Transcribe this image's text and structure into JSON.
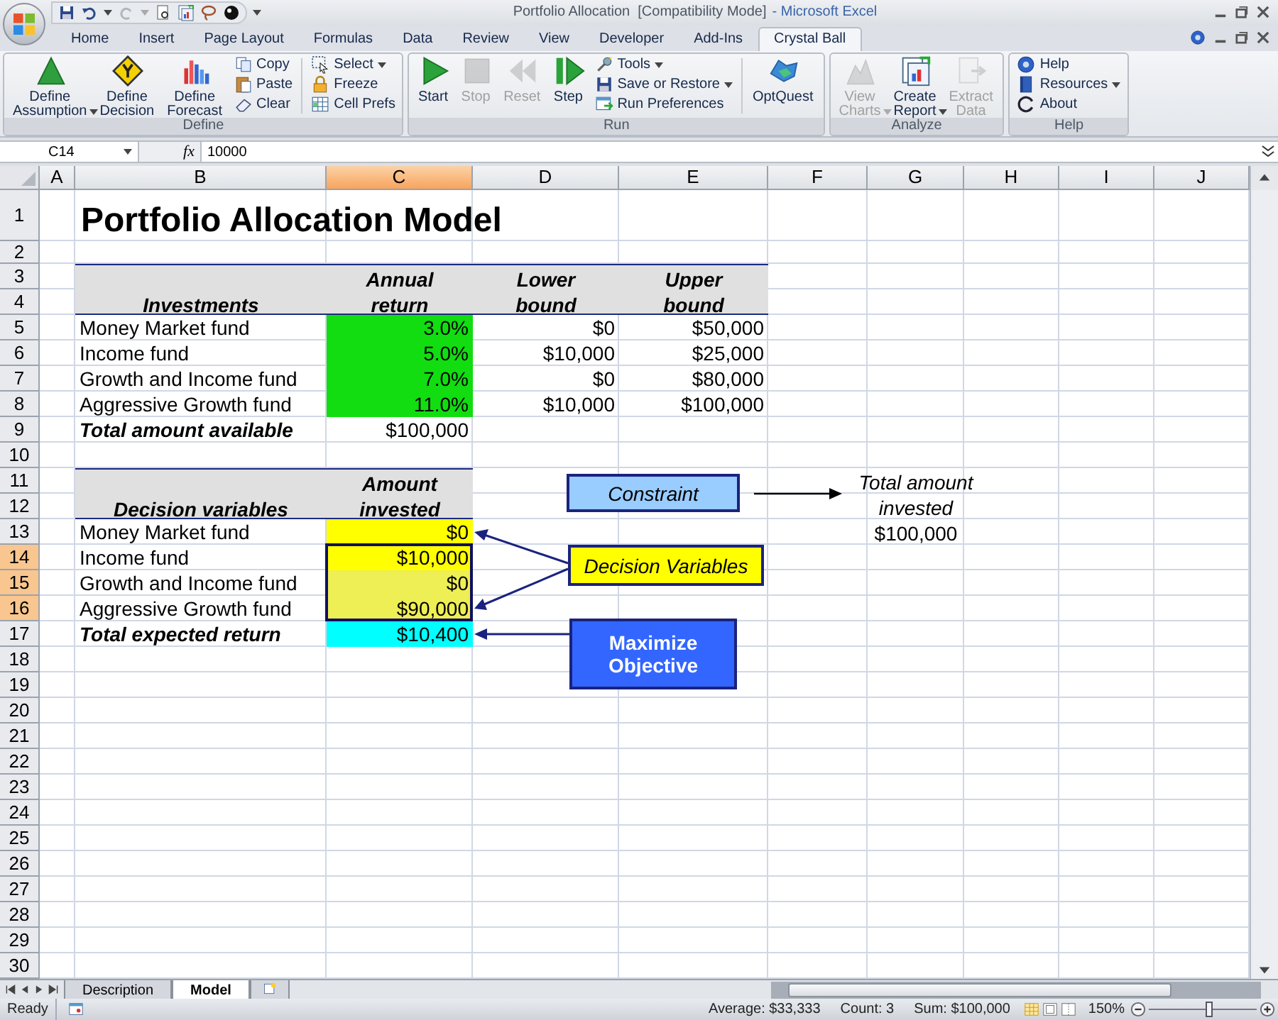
{
  "window": {
    "document": "Portfolio Allocation  [Compatibility Mode]",
    "app": "- Microsoft Excel"
  },
  "ribbon_tabs": [
    {
      "label": "Home",
      "selected": false
    },
    {
      "label": "Insert",
      "selected": false
    },
    {
      "label": "Page Layout",
      "selected": false
    },
    {
      "label": "Formulas",
      "selected": false
    },
    {
      "label": "Data",
      "selected": false
    },
    {
      "label": "Review",
      "selected": false
    },
    {
      "label": "View",
      "selected": false
    },
    {
      "label": "Developer",
      "selected": false
    },
    {
      "label": "Add-Ins",
      "selected": false
    },
    {
      "label": "Crystal Ball",
      "selected": true
    }
  ],
  "ribbon_groups": [
    {
      "label": "Define",
      "items": [
        {
          "label": "Define Assumption",
          "kind": "large",
          "dropdown": true,
          "disabled": false
        },
        {
          "label": "Define Decision",
          "kind": "large",
          "dropdown": false,
          "disabled": false
        },
        {
          "label": "Define Forecast",
          "kind": "large",
          "dropdown": false,
          "disabled": false
        },
        {
          "label": "Copy",
          "kind": "small",
          "dropdown": false,
          "disabled": false
        },
        {
          "label": "Paste",
          "kind": "small",
          "dropdown": false,
          "disabled": false
        },
        {
          "label": "Clear",
          "kind": "small",
          "dropdown": false,
          "disabled": false
        },
        {
          "label": "Select",
          "kind": "small",
          "dropdown": true,
          "disabled": false
        },
        {
          "label": "Freeze",
          "kind": "small",
          "dropdown": false,
          "disabled": false
        },
        {
          "label": "Cell Prefs",
          "kind": "small",
          "dropdown": false,
          "disabled": false
        }
      ]
    },
    {
      "label": "Run",
      "items": [
        {
          "label": "Start",
          "kind": "large",
          "dropdown": false,
          "disabled": false
        },
        {
          "label": "Stop",
          "kind": "large",
          "dropdown": false,
          "disabled": true
        },
        {
          "label": "Reset",
          "kind": "large",
          "dropdown": false,
          "disabled": true
        },
        {
          "label": "Step",
          "kind": "large",
          "dropdown": false,
          "disabled": false
        },
        {
          "label": "Tools",
          "kind": "small",
          "dropdown": true,
          "disabled": false
        },
        {
          "label": "Save or Restore",
          "kind": "small",
          "dropdown": true,
          "disabled": false
        },
        {
          "label": "Run Preferences",
          "kind": "small",
          "dropdown": false,
          "disabled": false
        },
        {
          "label": "OptQuest",
          "kind": "large",
          "dropdown": false,
          "disabled": false
        }
      ]
    },
    {
      "label": "Analyze",
      "items": [
        {
          "label": "View Charts",
          "kind": "large",
          "dropdown": true,
          "disabled": true
        },
        {
          "label": "Create Report",
          "kind": "large",
          "dropdown": true,
          "disabled": false
        },
        {
          "label": "Extract Data",
          "kind": "large",
          "dropdown": false,
          "disabled": true
        }
      ]
    },
    {
      "label": "Help",
      "items": [
        {
          "label": "Help",
          "kind": "small",
          "dropdown": false,
          "disabled": false
        },
        {
          "label": "Resources",
          "kind": "small",
          "dropdown": true,
          "disabled": false
        },
        {
          "label": "About",
          "kind": "small",
          "dropdown": false,
          "disabled": false
        }
      ]
    }
  ],
  "formula_bar": {
    "name_box": "C14",
    "function_label": "fx",
    "formula": "10000"
  },
  "columns": [
    {
      "label": "A",
      "selected": false
    },
    {
      "label": "B",
      "selected": false
    },
    {
      "label": "C",
      "selected": true
    },
    {
      "label": "D",
      "selected": false
    },
    {
      "label": "E",
      "selected": false
    },
    {
      "label": "F",
      "selected": false
    },
    {
      "label": "G",
      "selected": false
    },
    {
      "label": "H",
      "selected": false
    },
    {
      "label": "I",
      "selected": false
    },
    {
      "label": "J",
      "selected": false
    }
  ],
  "rows": [
    {
      "label": "1",
      "selected": false,
      "cells": [
        {
          "kind": "title",
          "text": "Portfolio Allocation Model"
        }
      ]
    },
    {
      "label": "2",
      "selected": false
    },
    {
      "label": "3",
      "selected": false,
      "cells": [
        {
          "kind": "header_top",
          "color": "#e0e0e0"
        },
        {
          "kind": "header_top",
          "text": "Annual",
          "color": "#e0e0e0"
        },
        {
          "kind": "header_top",
          "text": "Lower",
          "color": "#e0e0e0"
        },
        {
          "kind": "header_top",
          "text": "Upper",
          "color": "#e0e0e0"
        }
      ]
    },
    {
      "label": "4",
      "selected": false,
      "cells": [
        {
          "kind": "header_bottom",
          "text": "Investments",
          "color": "#e0e0e0"
        },
        {
          "kind": "header_bottom",
          "text": "return",
          "color": "#e0e0e0"
        },
        {
          "kind": "header_bottom",
          "text": "bound",
          "color": "#e0e0e0"
        },
        {
          "kind": "header_bottom",
          "text": "bound",
          "color": "#e0e0e0"
        }
      ]
    },
    {
      "label": "5",
      "selected": false,
      "cells": [
        {
          "kind": "label",
          "text": "Money Market fund"
        },
        {
          "kind": "value",
          "text": "3.0%",
          "color": "#11dd11"
        },
        {
          "kind": "value",
          "text": "$0"
        },
        {
          "kind": "value",
          "text": "$50,000"
        }
      ]
    },
    {
      "label": "6",
      "selected": false,
      "cells": [
        {
          "kind": "label",
          "text": "Income fund"
        },
        {
          "kind": "value",
          "text": "5.0%",
          "color": "#11dd11"
        },
        {
          "kind": "value",
          "text": "$10,000"
        },
        {
          "kind": "value",
          "text": "$25,000"
        }
      ]
    },
    {
      "label": "7",
      "selected": false,
      "cells": [
        {
          "kind": "label",
          "text": "Growth and Income fund"
        },
        {
          "kind": "value",
          "text": "7.0%",
          "color": "#11dd11"
        },
        {
          "kind": "value",
          "text": "$0"
        },
        {
          "kind": "value",
          "text": "$80,000"
        }
      ]
    },
    {
      "label": "8",
      "selected": false,
      "cells": [
        {
          "kind": "label",
          "text": "Aggressive Growth fund"
        },
        {
          "kind": "value",
          "text": "11.0%",
          "color": "#11dd11"
        },
        {
          "kind": "value",
          "text": "$10,000"
        },
        {
          "kind": "value",
          "text": "$100,000"
        }
      ]
    },
    {
      "label": "9",
      "selected": false,
      "cells": [
        {
          "kind": "total",
          "text": "Total amount available"
        },
        {
          "kind": "value",
          "text": "$100,000"
        }
      ]
    },
    {
      "label": "10",
      "selected": false
    },
    {
      "label": "11",
      "selected": false,
      "cells": [
        {
          "kind": "header_top",
          "color": "#e0e0e0"
        },
        {
          "kind": "header_top",
          "text": "Amount",
          "color": "#e0e0e0"
        }
      ]
    },
    {
      "label": "12",
      "selected": false,
      "cells": [
        {
          "kind": "header_bottom",
          "text": "Decision variables",
          "color": "#e0e0e0"
        },
        {
          "kind": "header_bottom",
          "text": "invested",
          "color": "#e0e0e0"
        }
      ]
    },
    {
      "label": "13",
      "selected": false,
      "cells": [
        {
          "kind": "label",
          "text": "Money Market fund"
        },
        {
          "kind": "value",
          "text": "$0",
          "color": "#ffff00"
        }
      ]
    },
    {
      "label": "14",
      "selected": true,
      "cells": [
        {
          "kind": "label",
          "text": "Income fund"
        },
        {
          "kind": "value",
          "text": "$10,000",
          "color": "#ffff00"
        }
      ]
    },
    {
      "label": "15",
      "selected": true,
      "cells": [
        {
          "kind": "label",
          "text": "Growth and Income fund"
        },
        {
          "kind": "value",
          "text": "$0",
          "color": "#eeee55"
        }
      ]
    },
    {
      "label": "16",
      "selected": true,
      "cells": [
        {
          "kind": "label",
          "text": "Aggressive Growth fund"
        },
        {
          "kind": "value",
          "text": "$90,000",
          "color": "#eeee55"
        }
      ]
    },
    {
      "label": "17",
      "selected": false,
      "cells": [
        {
          "kind": "total",
          "text": "Total expected return"
        },
        {
          "kind": "value",
          "text": "$10,400",
          "color": "#00ffff"
        }
      ]
    },
    {
      "label": "18",
      "selected": false
    },
    {
      "label": "19",
      "selected": false
    },
    {
      "label": "20",
      "selected": false
    },
    {
      "label": "21",
      "selected": false
    },
    {
      "label": "22",
      "selected": false
    },
    {
      "label": "23",
      "selected": false
    },
    {
      "label": "24",
      "selected": false
    },
    {
      "label": "25",
      "selected": false
    },
    {
      "label": "26",
      "selected": false
    },
    {
      "label": "27",
      "selected": false
    },
    {
      "label": "28",
      "selected": false
    },
    {
      "label": "29",
      "selected": false
    },
    {
      "label": "30",
      "selected": false
    }
  ],
  "annotations": [
    {
      "kind": "box",
      "text": "Constraint",
      "color": "#99ccff"
    },
    {
      "kind": "box",
      "text": "Decision Variables",
      "color": "#ffff00"
    },
    {
      "kind": "box",
      "text": "Maximize Objective",
      "color": "#3366ff"
    },
    {
      "kind": "note",
      "label": "Total amount invested",
      "value": "$100,000"
    }
  ],
  "sheet_tabs": [
    {
      "label": "Description",
      "selected": false
    },
    {
      "label": "Model",
      "selected": true
    }
  ],
  "status_bar": {
    "mode": "Ready",
    "average": "Average: $33,333",
    "count": "Count: 3",
    "sum": "Sum: $100,000",
    "zoom": "150%",
    "zoom_slider": {
      "level": 0.57
    }
  }
}
